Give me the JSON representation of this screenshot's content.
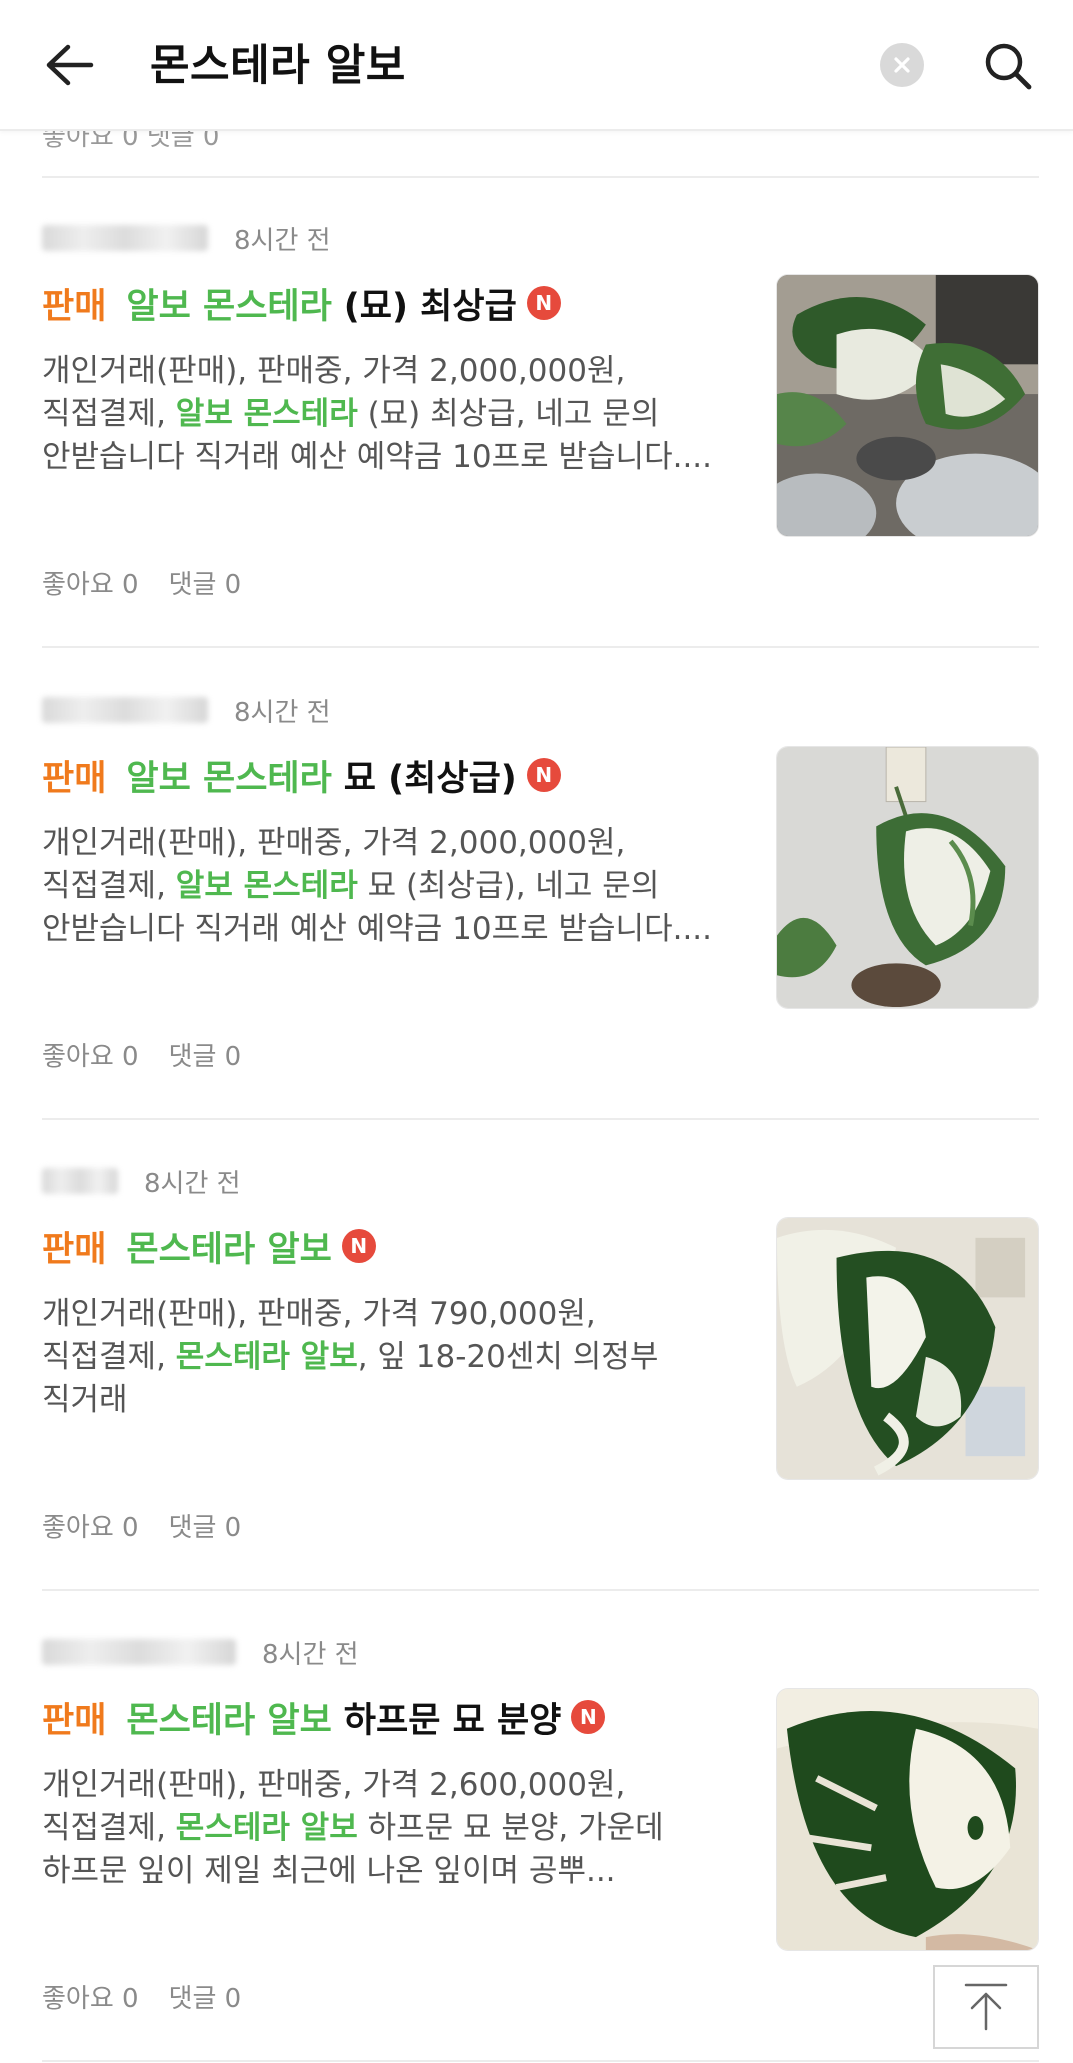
{
  "header": {
    "query": "몬스테라 알보",
    "back_icon": "arrow-left-icon",
    "clear_icon": "close-circle-icon",
    "search_icon": "search-icon"
  },
  "partial_top_text": "좋아요 0   댓글 0",
  "colors": {
    "sale_tag": "#f07a1c",
    "keyword": "#4fb84f",
    "new_badge": "#e64a3c"
  },
  "posts": [
    {
      "time": "8시간 전",
      "tag": "판매",
      "keyword": "알보 몬스테라",
      "title_rest": "(묘) 최상급",
      "badge": "N",
      "desc_line1": "개인거래(판매), 판매중, 가격 2,000,000원,",
      "desc_line2_prefix": "직접결제, ",
      "desc_line2_keyword": "알보 몬스테라",
      "desc_line2_suffix": " (묘) 최상급, 네고 문의",
      "desc_line3": "안받습니다 직거래 예산 예약금 10프로 받습니다....",
      "likes": "좋아요 0",
      "comments": "댓글 0"
    },
    {
      "time": "8시간 전",
      "tag": "판매",
      "keyword": "알보 몬스테라",
      "title_rest": "묘 (최상급)",
      "badge": "N",
      "desc_line1": "개인거래(판매), 판매중, 가격 2,000,000원,",
      "desc_line2_prefix": "직접결제, ",
      "desc_line2_keyword": "알보 몬스테라",
      "desc_line2_suffix": " 묘 (최상급), 네고 문의",
      "desc_line3": "안받습니다 직거래 예산 예약금 10프로 받습니다....",
      "likes": "좋아요 0",
      "comments": "댓글 0"
    },
    {
      "time": "8시간 전",
      "tag": "판매",
      "keyword": "몬스테라 알보",
      "title_rest": "",
      "badge": "N",
      "desc_line1": "개인거래(판매), 판매중, 가격 790,000원,",
      "desc_line2_prefix": "직접결제, ",
      "desc_line2_keyword": "몬스테라 알보",
      "desc_line2_suffix": ", 잎 18-20센치 의정부",
      "desc_line3": "직거래",
      "likes": "좋아요 0",
      "comments": "댓글 0"
    },
    {
      "time": "8시간 전",
      "tag": "판매",
      "keyword": "몬스테라 알보",
      "title_rest": "하프문 묘 분양",
      "badge": "N",
      "desc_line1": "개인거래(판매), 판매중, 가격 2,600,000원,",
      "desc_line2_prefix": "직접결제, ",
      "desc_line2_keyword": "몬스테라 알보",
      "desc_line2_suffix": " 하프문 묘 분양, 가운데",
      "desc_line3": "하프문 잎이 제일 최근에 나온 잎이며 공뿌...",
      "likes": "좋아요 0",
      "comments": "댓글 0"
    }
  ],
  "to_top_icon": "arrow-up-to-top-icon"
}
